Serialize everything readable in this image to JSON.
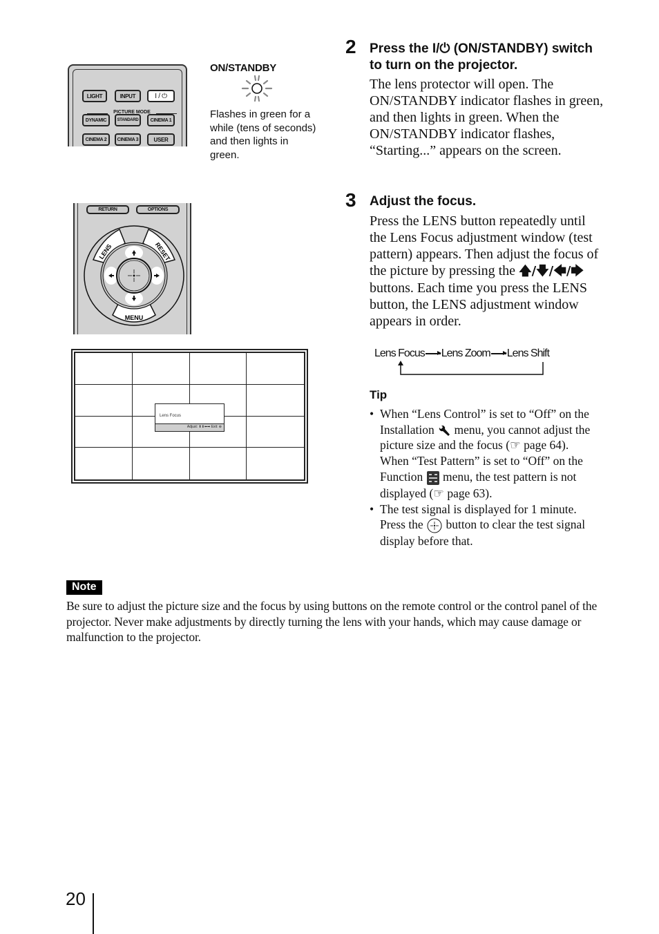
{
  "remote_top": {
    "buttons": {
      "light": "LIGHT",
      "input": "INPUT",
      "power": "I / ⏻",
      "picture_mode_label": "PICTURE MODE",
      "dynamic": "DYNAMIC",
      "standard": "STANDARD",
      "cinema1": "CINEMA 1",
      "cinema2": "CINEMA 2",
      "cinema3": "CINEMA 3",
      "user": "USER"
    }
  },
  "indicator": {
    "title": "ON/STANDBY",
    "description": "Flashes in green for a while (tens of seconds) and then lights in green."
  },
  "remote_bottom": {
    "buttons": {
      "return": "RETURN",
      "options": "OPTIONS",
      "lens": "LENS",
      "reset": "RESET",
      "menu": "MENU"
    }
  },
  "test_pattern": {
    "window_title": "Lens Focus",
    "status_bar": "Adjust: ⬆⬇⬅➡  Exit: ⊕"
  },
  "steps": [
    {
      "number": "2",
      "heading": "Press the I/⏻ (ON/STANDBY) switch to turn on the projector.",
      "body": "The lens protector will open. The ON/STANDBY indicator flashes in green, and then lights in green. When the ON/STANDBY indicator flashes, “Starting...” appears on the screen."
    },
    {
      "number": "3",
      "heading": "Adjust the focus.",
      "body_before_arrows": "Press the LENS button repeatedly until the Lens Focus adjustment window (test pattern) appears. Then adjust the focus of the picture by pressing the ",
      "arrows": "🡅/🡇/🡄/🡆",
      "body_after_arrows": " buttons. Each time you press the LENS button, the LENS adjustment window appears in order."
    }
  ],
  "sequence": [
    "Lens Focus",
    "Lens Zoom",
    "Lens Shift"
  ],
  "tip": {
    "heading": "Tip",
    "items": [
      {
        "part1": "When “Lens Control” is set to “Off” on the Installation ",
        "part2": " menu, you cannot adjust the picture size and the focus (",
        "part3": " page 64).",
        "part4": "When “Test Pattern” is set to “Off” on the Function ",
        "part5": " menu, the test pattern is not displayed (",
        "part6": " page 63)."
      },
      {
        "part1": "The test signal is displayed for 1 minute. Press the ",
        "part2": " button to clear the test signal display before that."
      }
    ],
    "ref_symbol": "☞"
  },
  "note": {
    "badge": "Note",
    "text": "Be sure to adjust the picture size and the focus by using buttons on the remote control or the control panel of the projector. Never make adjustments by directly turning the lens with your hands, which may cause damage or malfunction to the projector."
  },
  "page_number": "20"
}
